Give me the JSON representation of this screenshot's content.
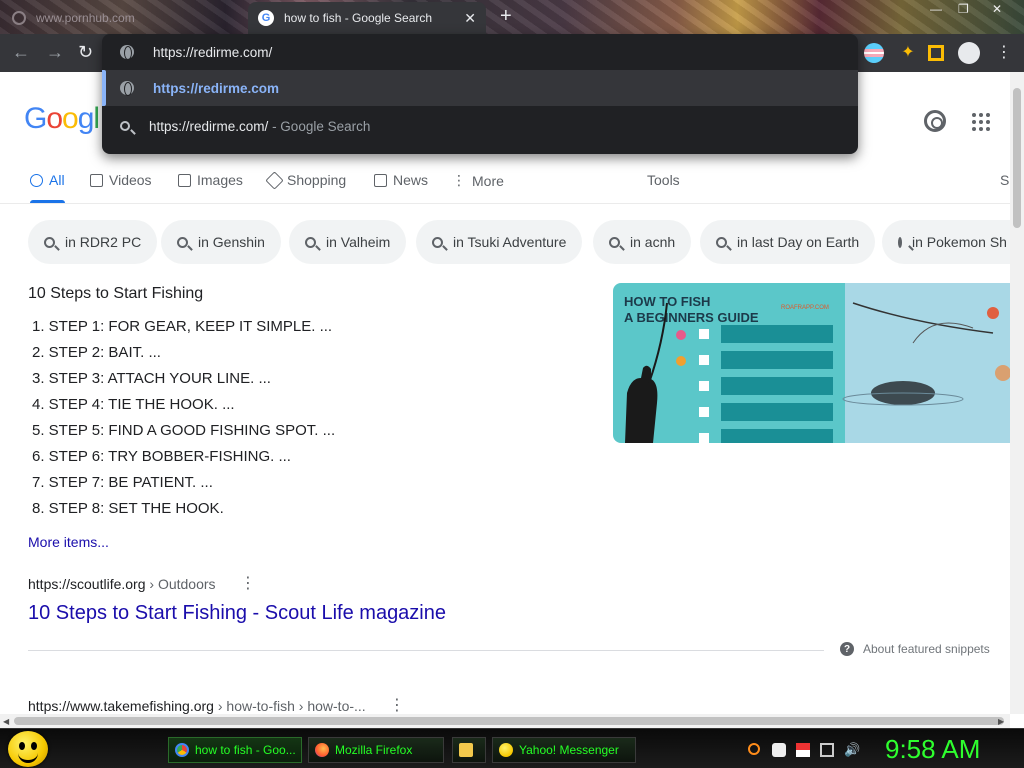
{
  "browser": {
    "inactive_tab_title": "www.pornhub.com",
    "active_tab_title": "how to fish - Google Search",
    "address_text": "https://redirme.com/",
    "omnibox": {
      "suggestions": [
        {
          "text": "https://redirme.com",
          "type": "url"
        },
        {
          "text": "https://redirme.com/",
          "suffix": "- Google Search",
          "type": "search"
        }
      ]
    }
  },
  "google": {
    "logo": "Googl",
    "tabs": [
      {
        "label": "All",
        "icon": "search-icon"
      },
      {
        "label": "Videos",
        "icon": "video-icon"
      },
      {
        "label": "Images",
        "icon": "image-icon"
      },
      {
        "label": "Shopping",
        "icon": "tag-icon"
      },
      {
        "label": "News",
        "icon": "news-icon"
      },
      {
        "label": "More",
        "icon": "more-vert-icon"
      }
    ],
    "tools_label": "Tools",
    "cutoff_label": "S",
    "chips": [
      "in RDR2 PC",
      "in Genshin",
      "in Valheim",
      "in Tsuki Adventure",
      "in acnh",
      "in last Day on Earth",
      "in Pokemon Sh"
    ],
    "snippet": {
      "title": "10 Steps to Start Fishing",
      "steps": [
        "1. STEP 1: FOR GEAR, KEEP IT SIMPLE. ...",
        "2. STEP 2: BAIT. ...",
        "3. STEP 3: ATTACH YOUR LINE. ...",
        "4. STEP 4: TIE THE HOOK. ...",
        "5. STEP 5: FIND A GOOD FISHING SPOT. ...",
        "6. STEP 6: TRY BOBBER-FISHING. ...",
        "7. STEP 7: BE PATIENT. ...",
        "8. STEP 8: SET THE HOOK."
      ],
      "more_items": "More items...",
      "image_title_line1": "HOW TO FISH",
      "image_title_line2": "A BEGINNERS GUIDE",
      "image_brand": "ROAFRAPP.COM",
      "source_url": "https://scoutlife.org",
      "source_crumb": " › Outdoors",
      "result_title": "10 Steps to Start Fishing - Scout Life magazine",
      "about_label": "About featured snippets"
    },
    "next_result": {
      "url": "https://www.takemefishing.org",
      "crumb": " › how-to-fish › how-to-..."
    }
  },
  "taskbar": {
    "tasks": [
      "how to fish - Goo...",
      "Mozilla Firefox",
      "",
      "Yahoo! Messenger"
    ],
    "clock": "9:58 AM"
  },
  "colors": {
    "google_blue": "#1a73e8",
    "link_blue": "#1a0dab",
    "taskbar_green": "#25ff25"
  }
}
